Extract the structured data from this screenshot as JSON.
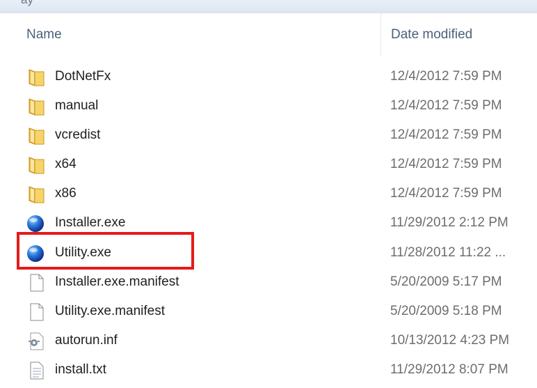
{
  "toolbar": {
    "clipped_text": "ay"
  },
  "columns": {
    "name": "Name",
    "date_modified": "Date modified"
  },
  "files": [
    {
      "name": "DotNetFx",
      "date": "12/4/2012 7:59 PM",
      "icon": "folder-icon"
    },
    {
      "name": "manual",
      "date": "12/4/2012 7:59 PM",
      "icon": "folder-icon"
    },
    {
      "name": "vcredist",
      "date": "12/4/2012 7:59 PM",
      "icon": "folder-icon"
    },
    {
      "name": "x64",
      "date": "12/4/2012 7:59 PM",
      "icon": "folder-icon"
    },
    {
      "name": "x86",
      "date": "12/4/2012 7:59 PM",
      "icon": "folder-icon"
    },
    {
      "name": "Installer.exe",
      "date": "11/29/2012 2:12 PM",
      "icon": "globe-exe-icon"
    },
    {
      "name": "Utility.exe",
      "date": "11/28/2012 11:22 ...",
      "icon": "globe-exe-icon"
    },
    {
      "name": "Installer.exe.manifest",
      "date": "5/20/2009 5:17 PM",
      "icon": "blank-file-icon"
    },
    {
      "name": "Utility.exe.manifest",
      "date": "5/20/2009 5:18 PM",
      "icon": "blank-file-icon"
    },
    {
      "name": "autorun.inf",
      "date": "10/13/2012 4:23 PM",
      "icon": "settings-file-icon"
    },
    {
      "name": "install.txt",
      "date": "11/29/2012 8:07 PM",
      "icon": "text-file-icon"
    }
  ],
  "highlight": {
    "target": "Utility.exe",
    "color": "#e41b1b"
  }
}
